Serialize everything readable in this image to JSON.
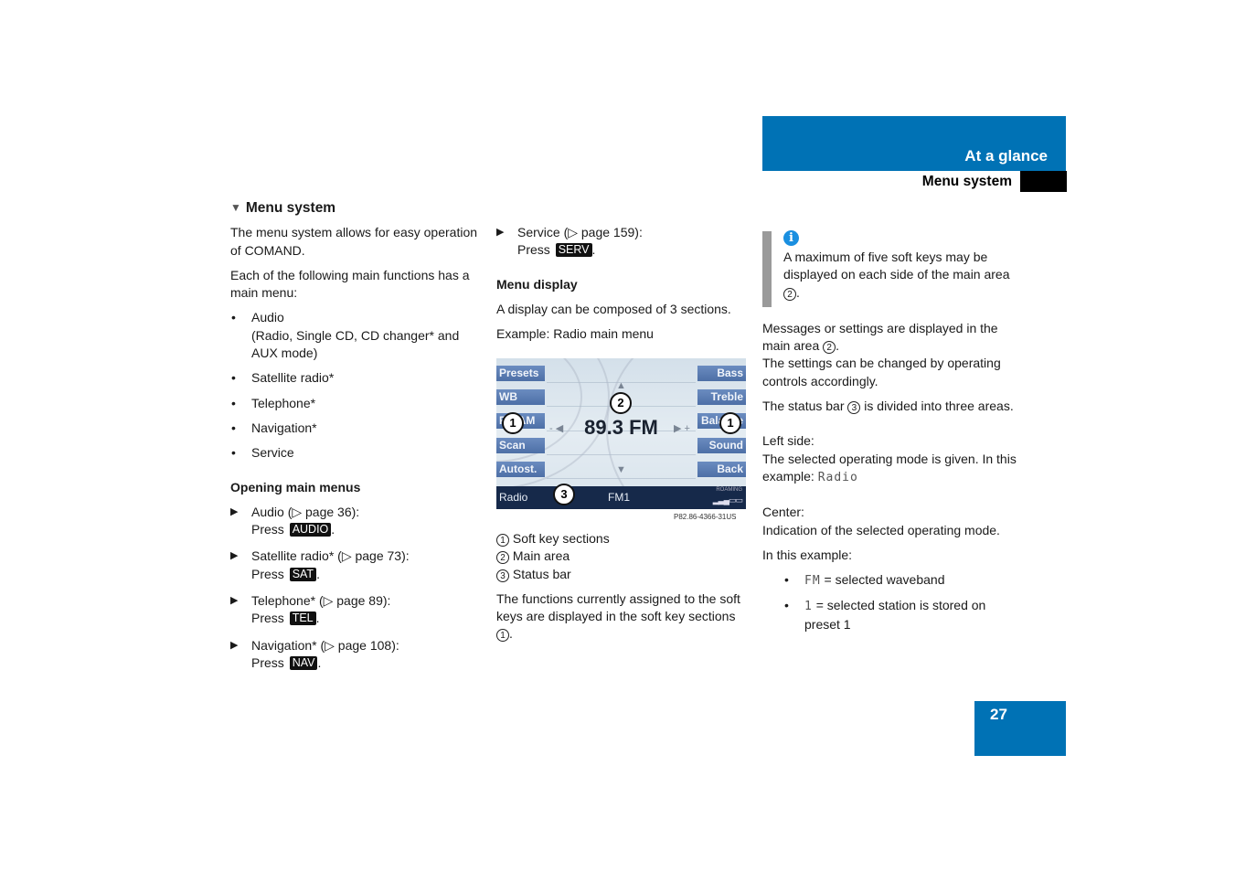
{
  "header": {
    "chapter": "At a glance",
    "section": "Menu system",
    "accent_color": "#0072b5"
  },
  "page_number": "27",
  "col1": {
    "heading_icon": "triangle-down-icon",
    "heading": "Menu system",
    "intro": "The menu system allows for easy operation of COMAND.",
    "intro2": "Each of the following main functions has a main menu:",
    "functions": [
      {
        "label": "Audio",
        "detail": "(Radio, Single CD, CD changer* and AUX mode)"
      },
      {
        "label": "Satellite radio*"
      },
      {
        "label": "Telephone*"
      },
      {
        "label": "Navigation*"
      },
      {
        "label": "Service"
      }
    ],
    "opening_heading": "Opening main menus",
    "steps": [
      {
        "text": "Audio (▷ page 36):",
        "press": "Press",
        "key": "AUDIO"
      },
      {
        "text": "Satellite radio* (▷ page 73):",
        "press": "Press",
        "key": "SAT"
      },
      {
        "text": "Telephone* (▷ page 89):",
        "press": "Press",
        "key": "TEL"
      },
      {
        "text": "Navigation* (▷ page 108):",
        "press": "Press",
        "key": "NAV"
      }
    ]
  },
  "col2": {
    "steps": [
      {
        "text": "Service (▷ page 159):",
        "press": "Press",
        "key": "SERV"
      }
    ],
    "menu_display_heading": "Menu display",
    "p1": "A display can be composed of 3 sections.",
    "p2": "Example: Radio main menu",
    "display": {
      "left_softkeys": [
        "Presets",
        "WB",
        "FM/AM",
        "Scan",
        "Autost."
      ],
      "right_softkeys": [
        "Bass",
        "Treble",
        "Balance",
        "Sound",
        "Back"
      ],
      "frequency": "89.3 FM",
      "status_left": "Radio",
      "status_center": "FM1",
      "status_right": "ROAMING",
      "callouts": [
        "1",
        "2",
        "3"
      ],
      "image_ref": "P82.86-4366-31US"
    },
    "legend": [
      {
        "num": "1",
        "label": "Soft key sections"
      },
      {
        "num": "2",
        "label": "Main area"
      },
      {
        "num": "3",
        "label": "Status bar"
      }
    ],
    "p3_pre": "The functions currently assigned to the soft keys are displayed in the soft key sections",
    "p3_num": "1",
    "p3_post": "."
  },
  "col3": {
    "info_icon": "info-icon",
    "info_pre": "A maximum of five soft keys may be displayed on each side of the main area",
    "info_num": "2",
    "info_post": ".",
    "p1_pre": "Messages or settings are displayed in the main area",
    "p1_num": "2",
    "p1_post": ".",
    "p1b": "The settings can be changed by operating controls accordingly.",
    "p2_pre": "The status bar",
    "p2_num": "3",
    "p2_post": "is divided into three areas.",
    "left_label": "Left side:",
    "left_text": "The selected operating mode is given. In this example:",
    "left_example": "Radio",
    "center_label": "Center:",
    "center_text": "Indication of the selected operating mode.",
    "example_label": "In this example:",
    "examples": [
      {
        "code": "FM",
        "text": "= selected waveband"
      },
      {
        "code": "1",
        "text": "= selected station is stored on preset 1"
      }
    ]
  }
}
